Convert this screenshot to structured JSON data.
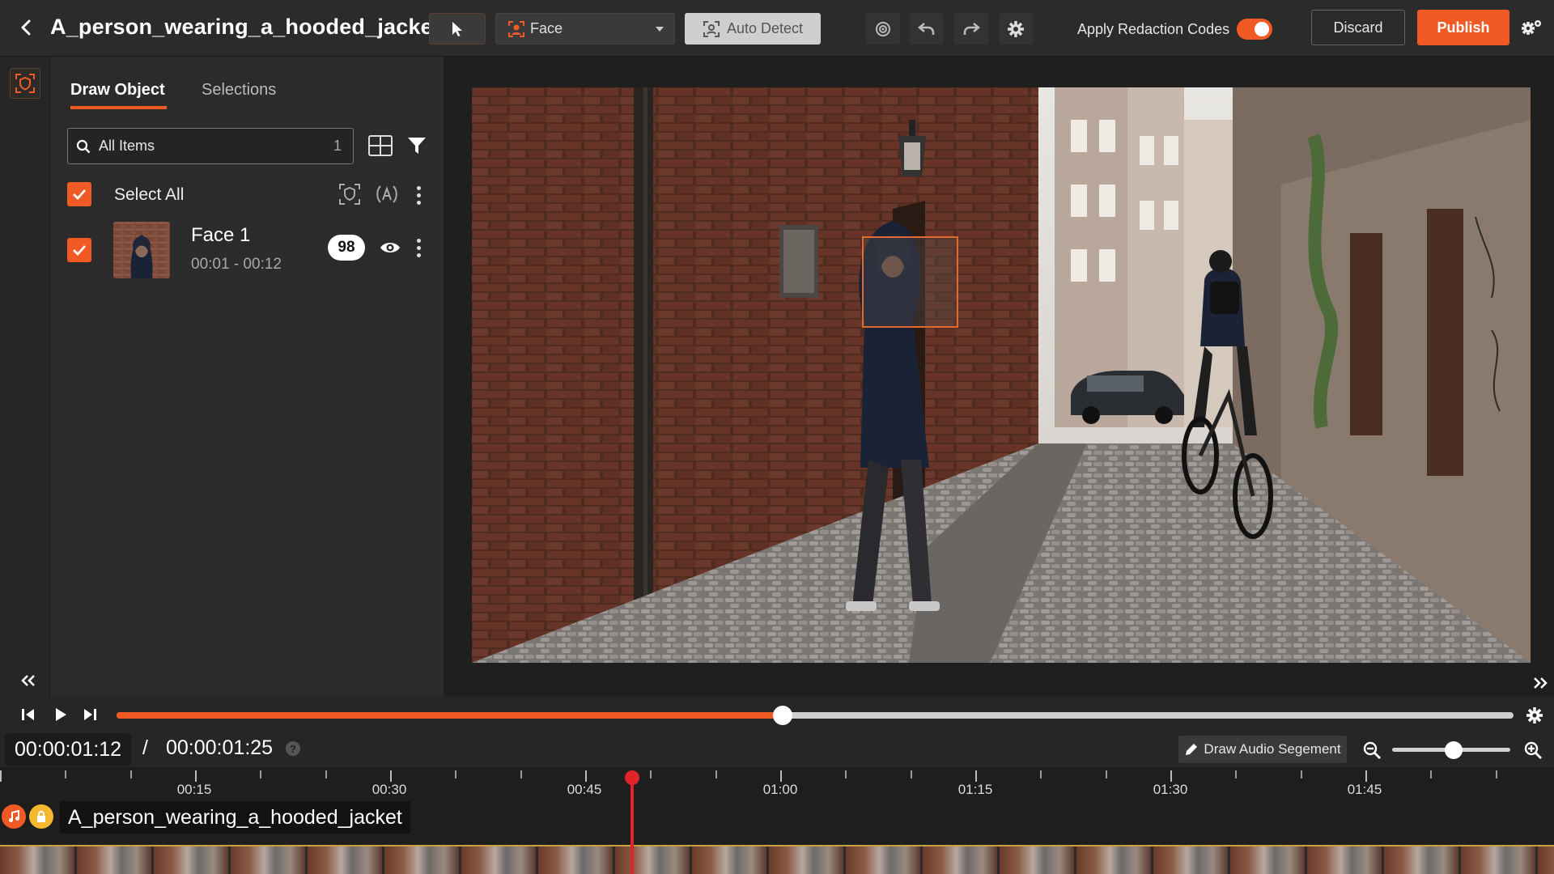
{
  "header": {
    "title": "A_person_wearing_a_hooded_jacket",
    "face_dropdown": "Face",
    "auto_detect": "Auto Detect",
    "apply_redaction_codes": "Apply Redaction Codes",
    "redaction_toggle_on": true,
    "discard": "Discard",
    "publish": "Publish"
  },
  "panel": {
    "tabs": [
      {
        "label": "Draw Object",
        "active": true
      },
      {
        "label": "Selections",
        "active": false
      }
    ],
    "search": {
      "value": "All Items",
      "count": "1"
    },
    "select_all": "Select All",
    "items": [
      {
        "name": "Face 1",
        "time": "00:01 - 00:12",
        "score": "98",
        "checked": true
      }
    ]
  },
  "player": {
    "progress": 0.477,
    "current_time": "00:00:01:12",
    "separator": "/",
    "total_time": "00:00:01:25",
    "help": "?",
    "draw_audio_segment": "Draw Audio Segement",
    "zoom_level": 0.52
  },
  "timeline": {
    "ticks": [
      "00:15",
      "00:30",
      "00:45",
      "01:00",
      "01:15",
      "01:30",
      "01:45"
    ],
    "track_name": "A_person_wearing_a_hooded_jacket"
  },
  "colors": {
    "accent": "#f15a24",
    "playhead": "#e0242a"
  },
  "icons": [
    "back-arrow-icon",
    "pointer-icon",
    "face-scan-icon",
    "auto-detect-icon",
    "target-icon",
    "undo-icon",
    "redo-icon",
    "gear-icon",
    "settings-gears-icon",
    "shield-face-icon",
    "search-icon",
    "grid-view-icon",
    "filter-icon",
    "check-icon",
    "eye-icon",
    "kebab-icon",
    "play-icon",
    "step-back-icon",
    "step-forward-icon",
    "pencil-icon",
    "zoom-out-icon",
    "zoom-in-icon",
    "music-icon",
    "lock-icon"
  ]
}
